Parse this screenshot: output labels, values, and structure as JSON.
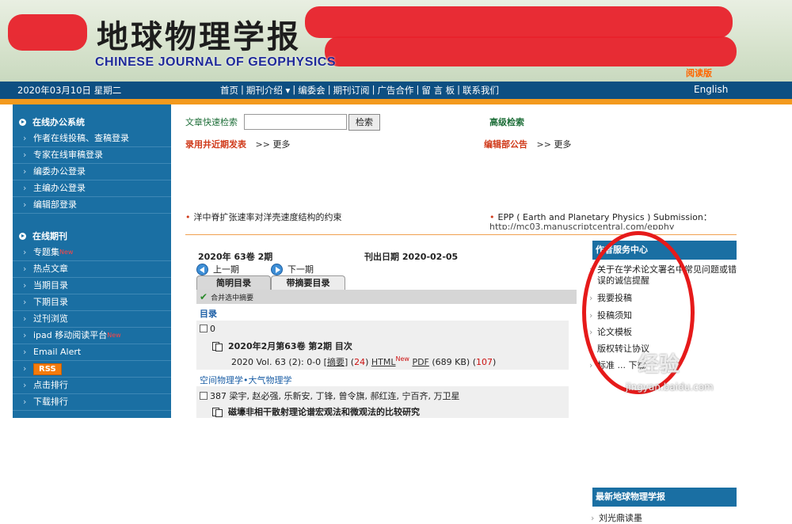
{
  "banner": {
    "title_cn": "地球物理学报",
    "title_en": "CHINESE JOURNAL OF GEOPHYSICS",
    "read_badge": "阅读版"
  },
  "navbar": {
    "date": "2020年03月10日 星期二",
    "menu": [
      "首页",
      "期刊介绍 ▾",
      "编委会",
      "期刊订阅",
      "广告合作",
      "留 言 板",
      "联系我们"
    ],
    "english": "English"
  },
  "sidebar": {
    "office_title": "在线办公系统",
    "office_items": [
      "作者在线投稿、查稿登录",
      "专家在线审稿登录",
      "编委办公登录",
      "主编办公登录",
      "编辑部登录"
    ],
    "journal_title": "在线期刊",
    "journal_items": [
      "专题集",
      "热点文章",
      "当期目录",
      "下期目录",
      "过刊浏览",
      "ipad 移动阅读平台",
      "Email Alert",
      "RSS",
      "点击排行",
      "下载排行"
    ],
    "new_label": "New"
  },
  "search": {
    "label": "文章快速检索",
    "input_value": "",
    "button": "检索",
    "advanced": "高级检索"
  },
  "sections": {
    "accepted": "录用井近期发表",
    "announce": "编辑部公告",
    "arrows": ">>",
    "more": "更多",
    "news_left": "洋中脊扩张速率对洋壳速度结构的约束",
    "news_right": "EPP ( Earth and Planetary Physics ) Submission：",
    "news_right_clip": "http://mc03.manuscriptcentral.com/epphy"
  },
  "issue": {
    "volume": "2020年 63卷 2期",
    "pub_date": "刊出日期 2020-02-05",
    "prev": "上一期",
    "next": "下一期",
    "tab_simple": "简明目录",
    "tab_abstract": "带摘要目录",
    "merge": "合并选中摘要",
    "toc": "目录"
  },
  "articles": [
    {
      "count": "0",
      "title": "2020年2月第63卷 第2期 目次",
      "cite": "2020 Vol. 63 (2): 0-0 [",
      "abstract": "摘要",
      "abstract_count": "24",
      "html": "HTML",
      "pdf": "PDF",
      "size": "(689 KB)",
      "pdf_count": "107"
    },
    {
      "category": "空间物理学•大气物理学",
      "count": "387",
      "authors": "梁宇, 赵必强, 乐新安, 丁锋, 曾令旗, 郝红连, 宁百齐, 万卫星",
      "title": "磁壕非相干散射理论谱宏观法和微观法的比较研究"
    }
  ],
  "right_panel": {
    "title": "作者服务中心",
    "items": [
      "关于在学术论文署名中常见问题或错误的诚信提醒",
      "我要投稿",
      "投稿须知",
      "论文模板",
      "版权转让协议",
      "标准 ... 下载"
    ],
    "title2": "最新地球物理学报",
    "reader": "刘光鼎读墨"
  },
  "watermark": {
    "brand": "经验",
    "url": "jingyan.baidu.com"
  }
}
